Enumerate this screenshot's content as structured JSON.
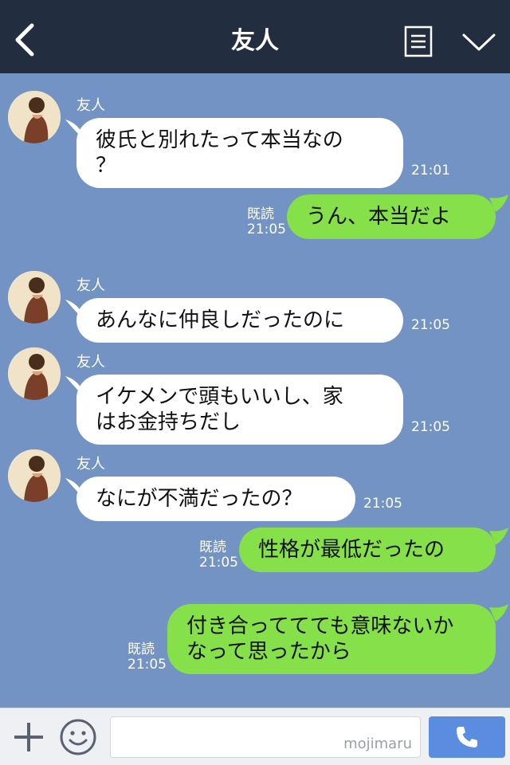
{
  "header": {
    "title": "友人"
  },
  "messages": [
    {
      "dir": "in",
      "sender": "友人",
      "lines": [
        "彼氏と別れたって本当なの",
        "？"
      ],
      "time": "21:01"
    },
    {
      "dir": "out",
      "read": "既読",
      "lines": [
        "うん、本当だよ"
      ],
      "time": "21:05"
    },
    {
      "dir": "in",
      "sender": "友人",
      "lines": [
        "あんなに仲良しだったのに"
      ],
      "time": "21:05"
    },
    {
      "dir": "in",
      "sender": "友人",
      "lines": [
        "イケメンで頭もいいし、家",
        "はお金持ちだし"
      ],
      "time": "21:05"
    },
    {
      "dir": "in",
      "sender": "友人",
      "lines": [
        "なにが不満だったの？"
      ],
      "time": "21:05"
    },
    {
      "dir": "out",
      "read": "既読",
      "lines": [
        "性格が最低だったの"
      ],
      "time": "21:05"
    },
    {
      "dir": "out",
      "read": "既読",
      "lines": [
        "付き合っててても意味ないか",
        "なって思ったから"
      ],
      "time": "21:05"
    }
  ],
  "input": {
    "watermark": "mojimaru"
  },
  "colors": {
    "header_bg": "#232d40",
    "chat_bg": "#7293c4",
    "outgoing_bubble": "#86e04a",
    "incoming_bubble": "#ffffff",
    "call_button": "#5a8de0"
  },
  "icons": {
    "back": "chevron-left-icon",
    "menu": "menu-list-icon",
    "collapse": "chevron-down-icon",
    "add": "plus-icon",
    "sticker": "smiley-icon",
    "call": "phone-icon"
  }
}
